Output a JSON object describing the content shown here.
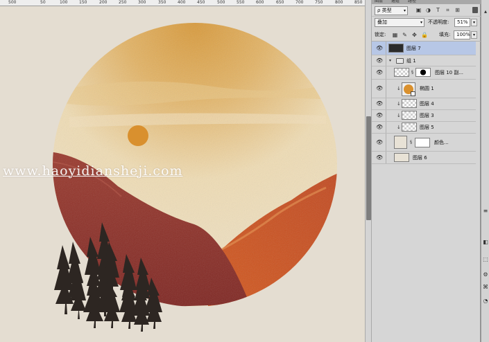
{
  "ruler": {
    "marks": [
      "500",
      "50",
      "100",
      "150",
      "200",
      "250",
      "300",
      "350",
      "400",
      "450",
      "500",
      "550",
      "600",
      "650",
      "700",
      "750",
      "800",
      "850"
    ]
  },
  "canvas": {
    "watermark": "www.haoyidiansheji.com",
    "colors": {
      "background": "#e4ddd1",
      "sun": "#d9902e",
      "sky_top": "#d9a24a",
      "sky_mid": "#ecd8ae",
      "hill_left": "#8f2e24",
      "hill_right": "#c9481c",
      "trees": "#2d2622"
    }
  },
  "panel": {
    "tabs": [
      "图层",
      "通道",
      "路径"
    ],
    "filter_select": "ρ 类型",
    "blend_mode": "叠加",
    "opacity_label": "不透明度:",
    "opacity_value": "51%",
    "lock_label": "锁定:",
    "fill_label": "填充:",
    "fill_value": "100%",
    "layers": [
      {
        "name": "图层 7"
      },
      {
        "name": "组 1"
      },
      {
        "name": "图层 10 副..."
      },
      {
        "name": "椭圆 1"
      },
      {
        "name": "图层 4"
      },
      {
        "name": "图层 3"
      },
      {
        "name": "图层 5"
      },
      {
        "name": "颜色..."
      },
      {
        "name": "图层 6"
      }
    ]
  }
}
